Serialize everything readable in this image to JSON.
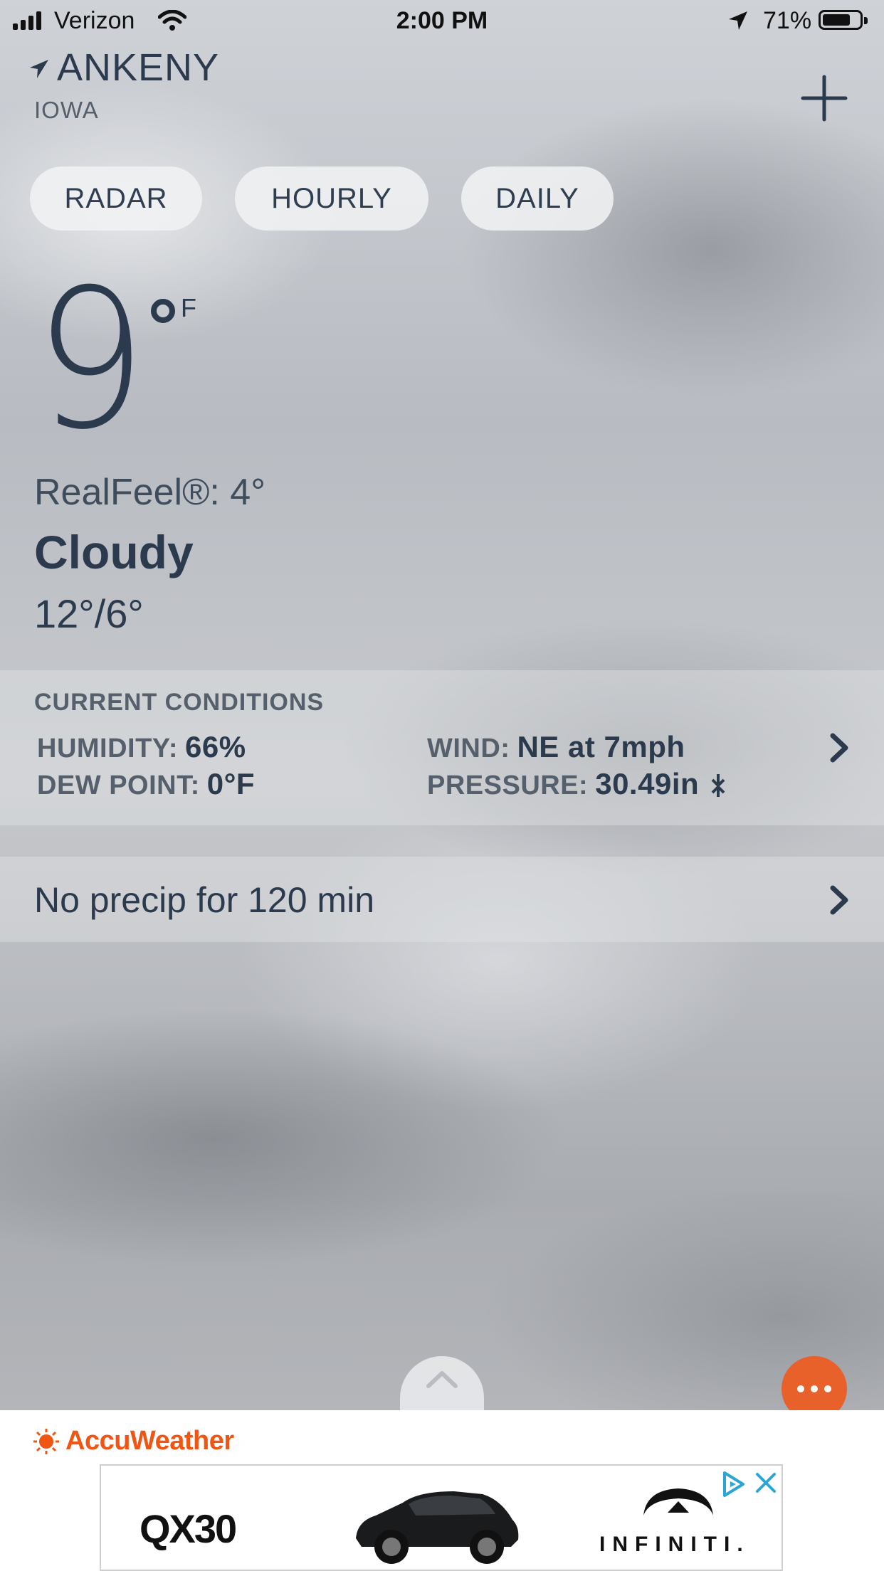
{
  "status_bar": {
    "carrier": "Verizon",
    "time": "2:00 PM",
    "battery": "71%",
    "battery_level": 0.71
  },
  "location": {
    "city": "ANKENY",
    "state": "IOWA"
  },
  "tabs": [
    {
      "label": "RADAR"
    },
    {
      "label": "HOURLY"
    },
    {
      "label": "DAILY"
    }
  ],
  "current": {
    "temperature": "9",
    "unit": "F",
    "realfeel": "RealFeel®: 4°",
    "condition": "Cloudy",
    "hi_lo": "12°/6°"
  },
  "conditions": {
    "title": "CURRENT CONDITIONS",
    "humidity_label": "HUMIDITY:",
    "humidity_value": "66%",
    "wind_label": "WIND:",
    "wind_value": "NE at 7mph",
    "dewpoint_label": "DEW POINT:",
    "dewpoint_value": "0°F",
    "pressure_label": "PRESSURE:",
    "pressure_value": "30.49in"
  },
  "precip": {
    "text": "No precip for 120 min"
  },
  "footer": {
    "brand": "AccuWeather",
    "ad_model": "QX30",
    "ad_brand": "INFINITI."
  },
  "colors": {
    "accent": "#e8602a",
    "brand": "#f05514",
    "text": "#2b3a4d"
  },
  "icons": [
    "signal-icon",
    "wifi-icon",
    "location-arrow-icon",
    "battery-icon",
    "plus-icon",
    "chevron-right-icon",
    "pressure-trend-icon",
    "chevron-up-icon",
    "more-icon",
    "sun-icon",
    "adchoices-icon",
    "close-icon"
  ]
}
